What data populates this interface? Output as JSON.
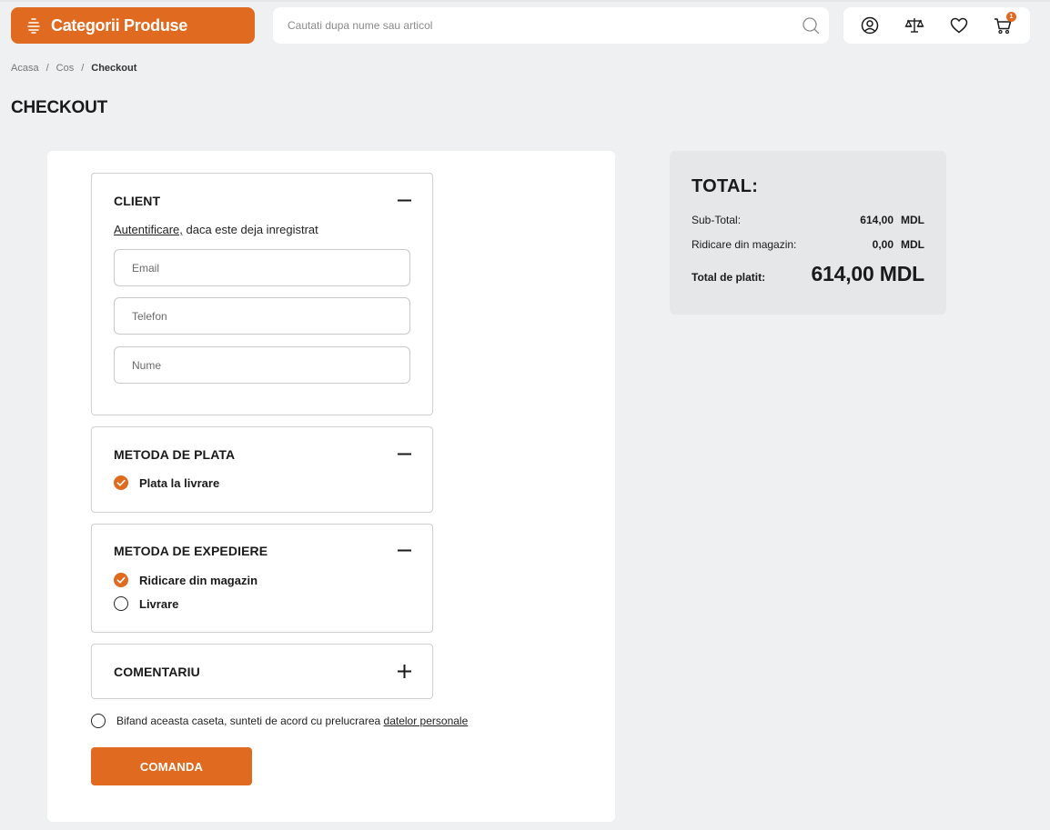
{
  "header": {
    "categories_label": "Categorii Produse",
    "search": {
      "placeholder": "Cautati dupa nume sau articol"
    },
    "cart_count": "1"
  },
  "breadcrumb": {
    "items": [
      "Acasa",
      "Cos"
    ],
    "current": "Checkout",
    "separator": "/"
  },
  "page_title": "CHECKOUT",
  "client": {
    "title": "CLIENT",
    "login_link": "Autentificare,",
    "login_text": "daca este deja inregistrat",
    "fields": {
      "email": "Email",
      "phone": "Telefon",
      "name": "Nume"
    }
  },
  "payment": {
    "title": "METODA DE PLATA",
    "options": [
      {
        "label": "Plata la livrare",
        "selected": true
      }
    ]
  },
  "shipping": {
    "title": "METODA DE EXPEDIERE",
    "options": [
      {
        "label": "Ridicare din magazin",
        "selected": true
      },
      {
        "label": "Livrare",
        "selected": false
      }
    ]
  },
  "comment": {
    "title": "COMENTARIU"
  },
  "consent": {
    "text": "Bifand aceasta caseta, sunteti de acord cu prelucrarea",
    "link": "datelor personale"
  },
  "order_button": "COMANDA",
  "totals": {
    "title": "TOTAL:",
    "subtotal_label": "Sub-Total:",
    "subtotal_value": "614,00",
    "pickup_label": "Ridicare din magazin:",
    "pickup_value": "0,00",
    "currency": "MDL",
    "total_label": "Total de platit:",
    "total_value": "614,00 MDL"
  },
  "colors": {
    "accent": "#e06a1f",
    "background": "#eef0f1",
    "summary_bg": "#e6e7e9"
  }
}
